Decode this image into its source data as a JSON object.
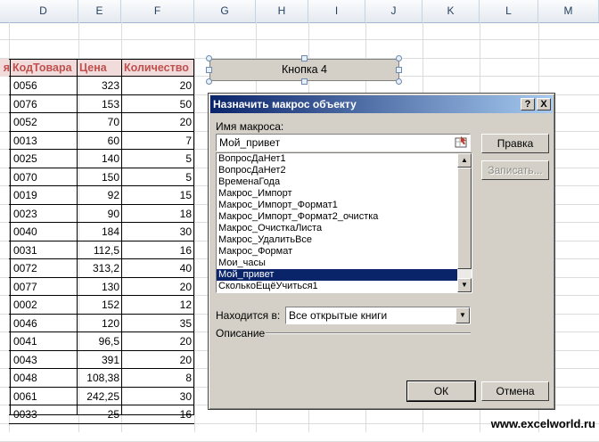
{
  "columns": [
    "D",
    "E",
    "F",
    "G",
    "H",
    "I",
    "J",
    "K",
    "L",
    "M"
  ],
  "table": {
    "headers": [
      "я",
      "КодТовара",
      "Цена",
      "Количество"
    ],
    "rows": [
      [
        "0056",
        "323",
        "20"
      ],
      [
        "0076",
        "153",
        "50"
      ],
      [
        "0052",
        "70",
        "20"
      ],
      [
        "0013",
        "60",
        "7"
      ],
      [
        "0025",
        "140",
        "5"
      ],
      [
        "0070",
        "150",
        "5"
      ],
      [
        "0019",
        "92",
        "15"
      ],
      [
        "0023",
        "90",
        "18"
      ],
      [
        "0040",
        "184",
        "30"
      ],
      [
        "0031",
        "112,5",
        "16"
      ],
      [
        "0072",
        "313,2",
        "40"
      ],
      [
        "0077",
        "130",
        "20"
      ],
      [
        "0002",
        "152",
        "12"
      ],
      [
        "0046",
        "120",
        "35"
      ],
      [
        "0041",
        "96,5",
        "20"
      ],
      [
        "0043",
        "391",
        "20"
      ],
      [
        "0048",
        "108,38",
        "8"
      ],
      [
        "0061",
        "242,25",
        "30"
      ],
      [
        "0033",
        "25",
        "16"
      ]
    ]
  },
  "shape_button": {
    "label": "Кнопка 4"
  },
  "dialog": {
    "title": "Назначить макрос объекту",
    "help_label": "?",
    "close_label": "X",
    "macro_name_label": "Имя макроса:",
    "macro_name_value": "Мой_привет",
    "macros": [
      "ВопросДаНет1",
      "ВопросДаНет2",
      "ВременаГода",
      "Макрос_Импорт",
      "Макрос_Импорт_Формат1",
      "Макрос_Импорт_Формат2_очистка",
      "Макрос_ОчисткаЛиста",
      "Макрос_УдалитьВсе",
      "Макрос_Формат",
      "Мои_часы",
      "Мой_привет",
      "СколькоЕщёУчиться1"
    ],
    "selected_macro": "Мой_привет",
    "edit_button": "Правка",
    "record_button": "Записать...",
    "location_label": "Находится в:",
    "location_value": "Все открытые книги",
    "description_label": "Описание",
    "ok_button": "ОК",
    "cancel_button": "Отмена"
  },
  "watermark": "www.excelworld.ru"
}
